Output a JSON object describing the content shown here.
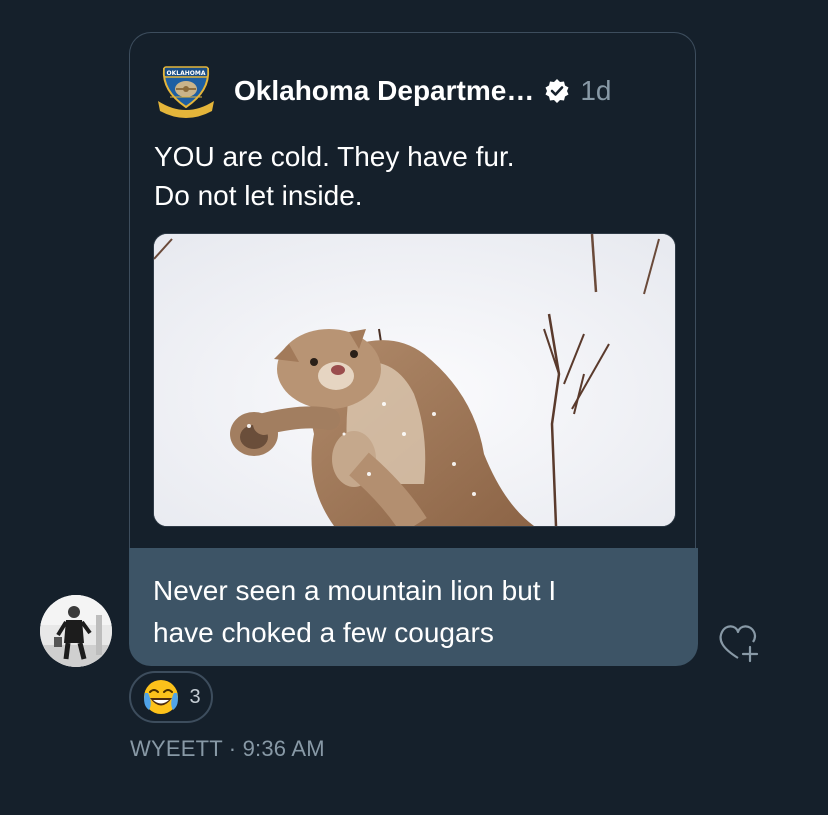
{
  "quote": {
    "org_logo": {
      "icon": "oklahoma-wildlife-badge-icon",
      "top_text": "OKLAHOMA"
    },
    "display_name": "Oklahoma Departme…",
    "verified_icon": "verified-badge-icon",
    "relative_time": "1d",
    "text_lines": [
      "YOU are cold. They have fur.",
      "Do not let inside."
    ],
    "media": {
      "icon": "mountain-lion-in-snow-photo"
    }
  },
  "message": {
    "text_lines": [
      "Never seen a mountain lion but I",
      "have choked a few cougars"
    ]
  },
  "sender": {
    "avatar": "avatar-photo",
    "name": "WYEETT",
    "separator": "·",
    "time": "9:36 AM"
  },
  "reaction": {
    "emoji": "face-with-tears-of-joy",
    "count": "3"
  },
  "actions": {
    "add_reaction_icon": "heart-plus-icon"
  },
  "colors": {
    "background": "#15202b",
    "bubble": "#3d5466",
    "border": "#3d4d5d",
    "muted_text": "#8899a6",
    "verified": "#ffffff"
  }
}
